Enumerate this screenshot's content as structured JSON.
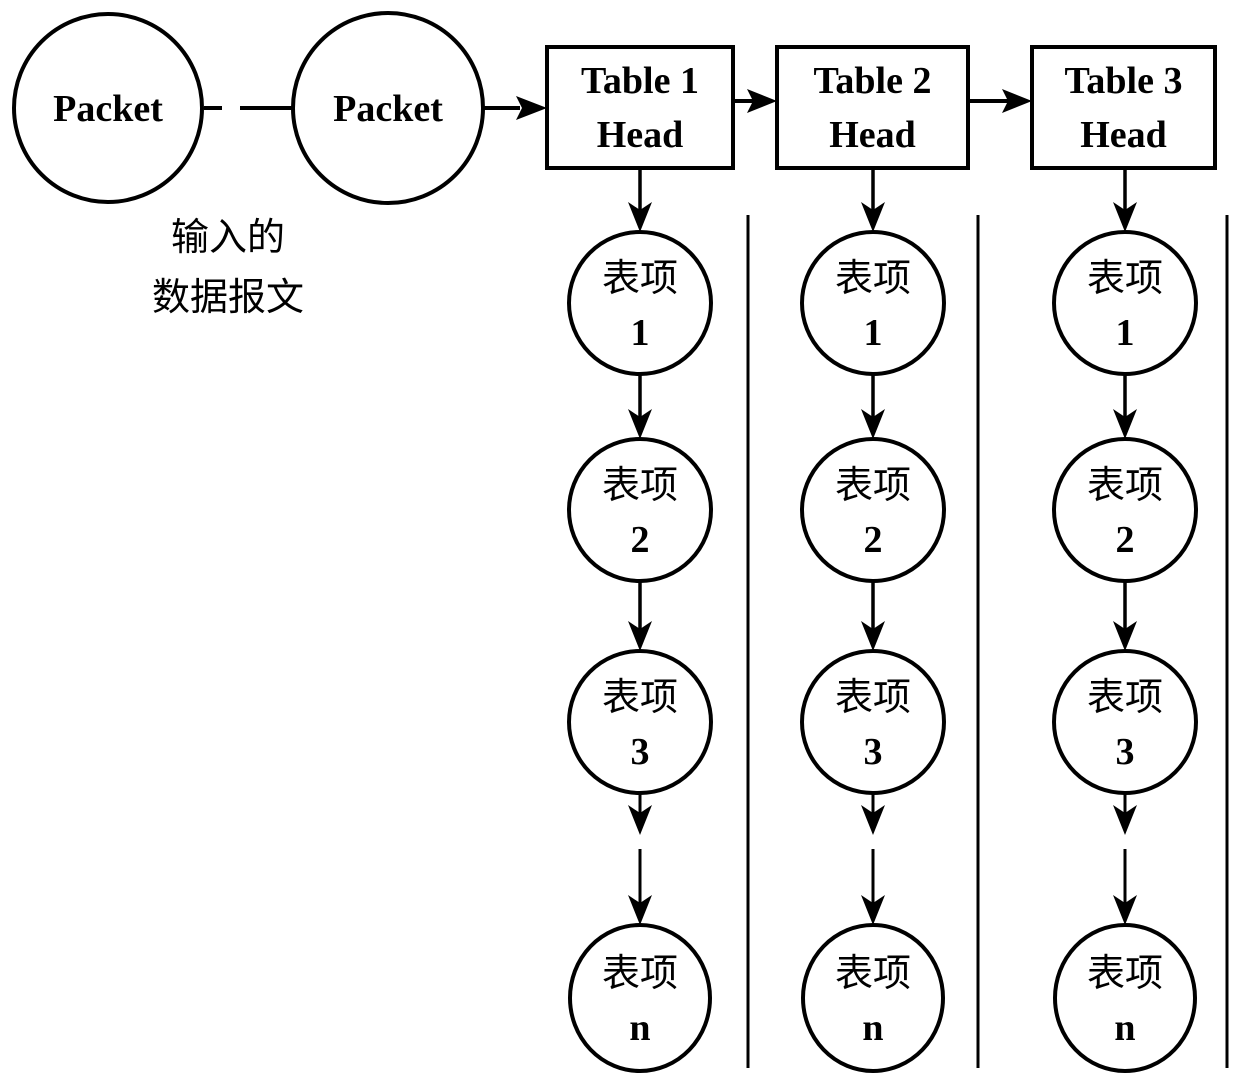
{
  "colors": {
    "stroke": "#000000",
    "background": "#ffffff"
  },
  "packets": [
    {
      "label": "Packet"
    },
    {
      "label": "Packet"
    }
  ],
  "packet_caption": {
    "line1": "输入的",
    "line2": "数据报文"
  },
  "tables": [
    {
      "line1": "Table 1",
      "line2": "Head",
      "entries": [
        {
          "label": "表项",
          "index": "1"
        },
        {
          "label": "表项",
          "index": "2"
        },
        {
          "label": "表项",
          "index": "3"
        },
        {
          "label": "表项",
          "index": "n"
        }
      ]
    },
    {
      "line1": "Table 2",
      "line2": "Head",
      "entries": [
        {
          "label": "表项",
          "index": "1"
        },
        {
          "label": "表项",
          "index": "2"
        },
        {
          "label": "表项",
          "index": "3"
        },
        {
          "label": "表项",
          "index": "n"
        }
      ]
    },
    {
      "line1": "Table 3",
      "line2": "Head",
      "entries": [
        {
          "label": "表项",
          "index": "1"
        },
        {
          "label": "表项",
          "index": "2"
        },
        {
          "label": "表项",
          "index": "3"
        },
        {
          "label": "表项",
          "index": "n"
        }
      ]
    }
  ]
}
